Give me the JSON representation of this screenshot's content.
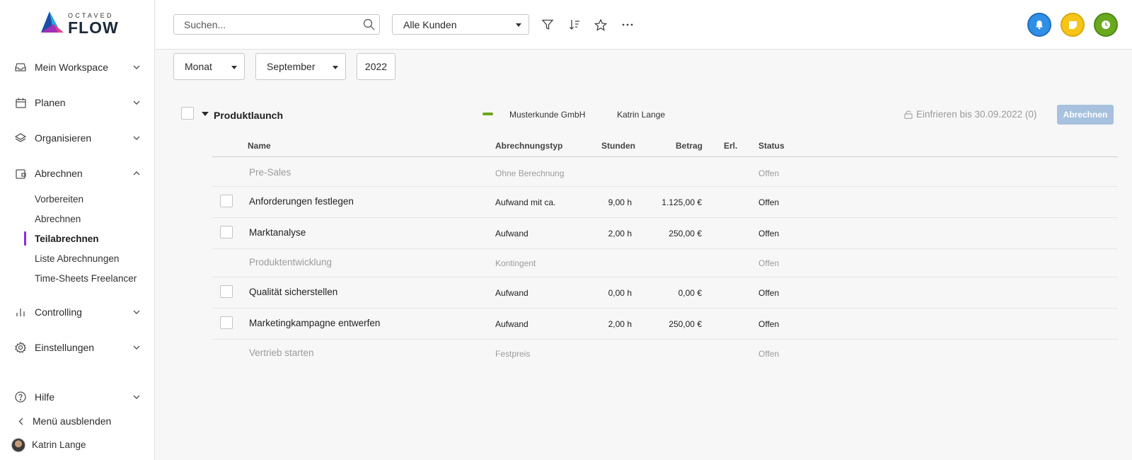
{
  "brand": {
    "sup": "OCTAVED",
    "main": "FLOW"
  },
  "sidebar": {
    "items": [
      {
        "label": "Mein Workspace",
        "icon": "inbox-icon"
      },
      {
        "label": "Planen",
        "icon": "calendar-icon"
      },
      {
        "label": "Organisieren",
        "icon": "layers-icon"
      },
      {
        "label": "Abrechnen",
        "icon": "wallet-icon"
      },
      {
        "label": "Controlling",
        "icon": "bar-chart-icon"
      },
      {
        "label": "Einstellungen",
        "icon": "gear-icon"
      }
    ],
    "subitems": [
      "Vorbereiten",
      "Abrechnen",
      "Teilabrechnen",
      "Liste Abrechnungen",
      "Time-Sheets Freelancer"
    ],
    "active_sub": "Teilabrechnen",
    "help": "Hilfe",
    "hide_menu": "Menü ausblenden",
    "user": "Katrin Lange",
    "accent": "#8a2be2"
  },
  "toolbar": {
    "search_placeholder": "Suchen...",
    "customer_select": "Alle Kunden",
    "icons": [
      "filter-icon",
      "sort-icon",
      "star-icon",
      "more-icon"
    ],
    "round_buttons": [
      {
        "icon": "bell-icon",
        "color": "#2f8ee5"
      },
      {
        "icon": "note-icon",
        "color": "#f5c518"
      },
      {
        "icon": "clock-icon",
        "color": "#6aa820"
      }
    ]
  },
  "filters": {
    "period": "Monat",
    "month": "September",
    "year": "2022"
  },
  "project": {
    "title": "Produktlaunch",
    "customer": "Musterkunde GmbH",
    "user": "Katrin Lange",
    "freeze": "Einfrieren bis 30.09.2022 (0)",
    "bill_button": "Abrechnen"
  },
  "table": {
    "headers": {
      "name": "Name",
      "type": "Abrechnungstyp",
      "hours": "Stunden",
      "amount": "Betrag",
      "done": "Erl.",
      "status": "Status"
    },
    "rows": [
      {
        "name": "Pre-Sales",
        "type": "Ohne Berechnung",
        "hours": "",
        "amount": "",
        "status": "Offen",
        "muted": true
      },
      {
        "name": "Anforderungen festlegen",
        "type": "Aufwand mit ca.",
        "hours": "9,00 h",
        "amount": "1.125,00 €",
        "status": "Offen",
        "muted": false
      },
      {
        "name": "Marktanalyse",
        "type": "Aufwand",
        "hours": "2,00 h",
        "amount": "250,00 €",
        "status": "Offen",
        "muted": false
      },
      {
        "name": "Produktentwicklung",
        "type": "Kontingent",
        "hours": "",
        "amount": "",
        "status": "Offen",
        "muted": true
      },
      {
        "name": "Qualität sicherstellen",
        "type": "Aufwand",
        "hours": "0,00 h",
        "amount": "0,00 €",
        "status": "Offen",
        "muted": false
      },
      {
        "name": "Marketingkampagne entwerfen",
        "type": "Aufwand",
        "hours": "2,00 h",
        "amount": "250,00 €",
        "status": "Offen",
        "muted": false
      },
      {
        "name": "Vertrieb starten",
        "type": "Festpreis",
        "hours": "",
        "amount": "",
        "status": "Offen",
        "muted": true
      }
    ]
  }
}
